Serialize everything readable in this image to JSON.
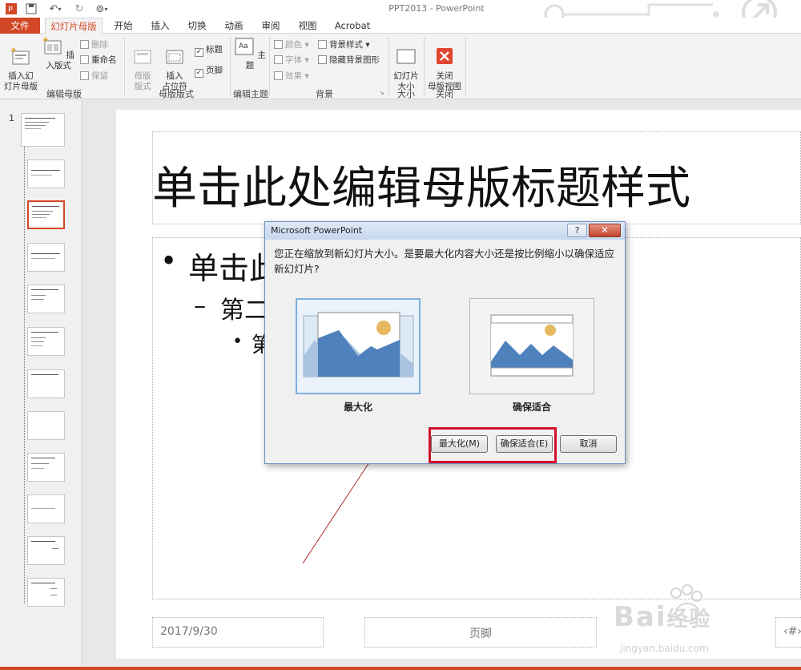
{
  "titlebar": {
    "app_title": "PPT2013 - PowerPoint"
  },
  "tabs": [
    "文件",
    "幻灯片母版",
    "开始",
    "插入",
    "切换",
    "动画",
    "审阅",
    "视图",
    "Acrobat"
  ],
  "ribbon": {
    "edit_master": {
      "insert_master": "插入幻\n灯片母版",
      "insert_layout": "插入版式",
      "delete": "删除",
      "rename": "重命名",
      "preserve": "保留",
      "group_label": "编辑母版"
    },
    "master_layout": {
      "master_layout_btn": "母版\n版式",
      "insert_placeholder": "插入\n占位符",
      "title_chk": "标题",
      "footer_chk": "页脚",
      "group_label": "母版版式"
    },
    "edit_theme": {
      "theme_btn": "主题",
      "group_label": "编辑主题"
    },
    "background": {
      "colors": "颜色",
      "fonts": "字体",
      "effects": "效果",
      "bg_styles": "背景样式",
      "hide_bg": "隐藏背景图形",
      "group_label": "背景"
    },
    "size": {
      "slide_size": "幻灯片\n大小",
      "group_label": "大小"
    },
    "close": {
      "close_master": "关闭\n母版视图",
      "group_label": "关闭"
    }
  },
  "thumbnails": {
    "slide_number": "1"
  },
  "slide": {
    "title": "单击此处编辑母版标题样式",
    "bullet1": "单击此",
    "bullet2": "第二",
    "bullet3": "第",
    "date": "2017/9/30",
    "footer": "页脚",
    "page_num": "‹#›"
  },
  "dialog": {
    "title": "Microsoft PowerPoint",
    "help": "?",
    "message": "您正在缩放到新幻灯片大小。是要最大化内容大小还是按比例缩小以确保适应新幻灯片?",
    "option_maximize": "最大化",
    "option_fit": "确保适合",
    "btn_maximize": "最大化(M)",
    "btn_fit": "确保适合(E)",
    "btn_cancel": "取消"
  },
  "watermark": {
    "brand": "Bai",
    "brand_suffix": "经验",
    "url": "jingyan.baidu.com"
  },
  "colors": {
    "accent": "#d24726",
    "highlight_red": "#d0102a",
    "picture_blue": "#4f81bd",
    "sun": "#e8b860"
  }
}
